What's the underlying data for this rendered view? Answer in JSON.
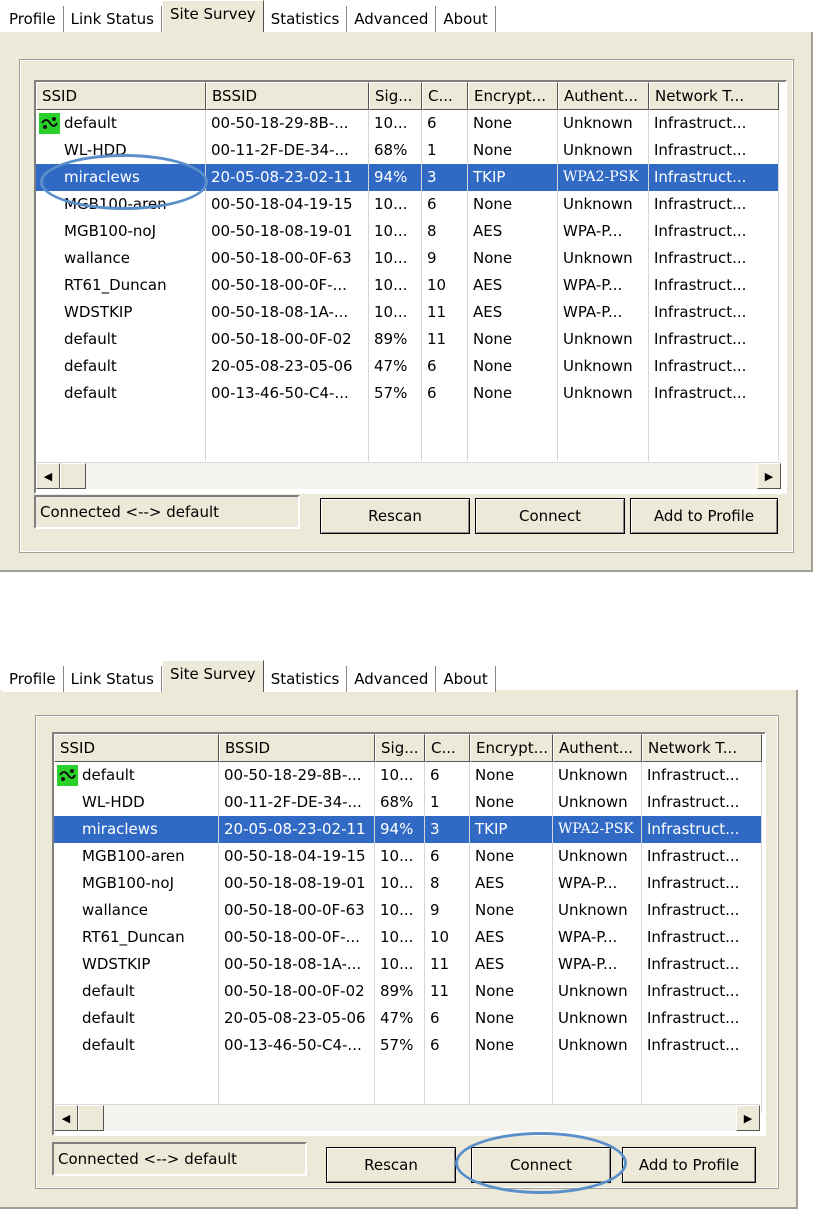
{
  "tabs": [
    "Profile",
    "Link Status",
    "Site Survey",
    "Statistics",
    "Advanced",
    "About"
  ],
  "active_tab": "Site Survey",
  "columns": [
    "SSID",
    "BSSID",
    "Sig...",
    "C...",
    "Encrypt...",
    "Authent...",
    "Network T..."
  ],
  "rows": [
    {
      "ssid": "default",
      "bssid": "00-50-18-29-8B-...",
      "signal": "10...",
      "channel": "6",
      "encryption": "None",
      "auth": "Unknown",
      "network": "Infrastruct...",
      "connected": true
    },
    {
      "ssid": "WL-HDD",
      "bssid": "00-11-2F-DE-34-...",
      "signal": "68%",
      "channel": "1",
      "encryption": "None",
      "auth": "Unknown",
      "network": "Infrastruct..."
    },
    {
      "ssid": "miraclews",
      "bssid": "20-05-08-23-02-11",
      "signal": "94%",
      "channel": "3",
      "encryption": "TKIP",
      "auth": "WPA2-PSK",
      "network": "Infrastruct...",
      "selected": true
    },
    {
      "ssid": "MGB100-aren",
      "bssid": "00-50-18-04-19-15",
      "signal": "10...",
      "channel": "6",
      "encryption": "None",
      "auth": "Unknown",
      "network": "Infrastruct..."
    },
    {
      "ssid": "MGB100-noJ",
      "bssid": "00-50-18-08-19-01",
      "signal": "10...",
      "channel": "8",
      "encryption": "AES",
      "auth": "WPA-P...",
      "network": "Infrastruct..."
    },
    {
      "ssid": "wallance",
      "bssid": "00-50-18-00-0F-63",
      "signal": "10...",
      "channel": "9",
      "encryption": "None",
      "auth": "Unknown",
      "network": "Infrastruct..."
    },
    {
      "ssid": "RT61_Duncan",
      "bssid": "00-50-18-00-0F-...",
      "signal": "10...",
      "channel": "10",
      "encryption": "AES",
      "auth": "WPA-P...",
      "network": "Infrastruct..."
    },
    {
      "ssid": "WDSTKIP",
      "bssid": "00-50-18-08-1A-...",
      "signal": "10...",
      "channel": "11",
      "encryption": "AES",
      "auth": "WPA-P...",
      "network": "Infrastruct..."
    },
    {
      "ssid": "default",
      "bssid": "00-50-18-00-0F-02",
      "signal": "89%",
      "channel": "11",
      "encryption": "None",
      "auth": "Unknown",
      "network": "Infrastruct..."
    },
    {
      "ssid": "default",
      "bssid": "20-05-08-23-05-06",
      "signal": "47%",
      "channel": "6",
      "encryption": "None",
      "auth": "Unknown",
      "network": "Infrastruct..."
    },
    {
      "ssid": "default",
      "bssid": "00-13-46-50-C4-...",
      "signal": "57%",
      "channel": "6",
      "encryption": "None",
      "auth": "Unknown",
      "network": "Infrastruct..."
    }
  ],
  "status_text": "Connected <--> default",
  "buttons": {
    "rescan": "Rescan",
    "connect": "Connect",
    "add_profile": "Add to Profile"
  },
  "scroll_left_icon": "arrow-left-icon",
  "scroll_right_icon": "arrow-right-icon",
  "connected_icon": "connected-network-icon",
  "colors": {
    "selection": "#316ac5",
    "highlight_ellipse": "#5b8fc9",
    "panel": "#ece9d8",
    "connected_icon": "#2bd12b"
  }
}
